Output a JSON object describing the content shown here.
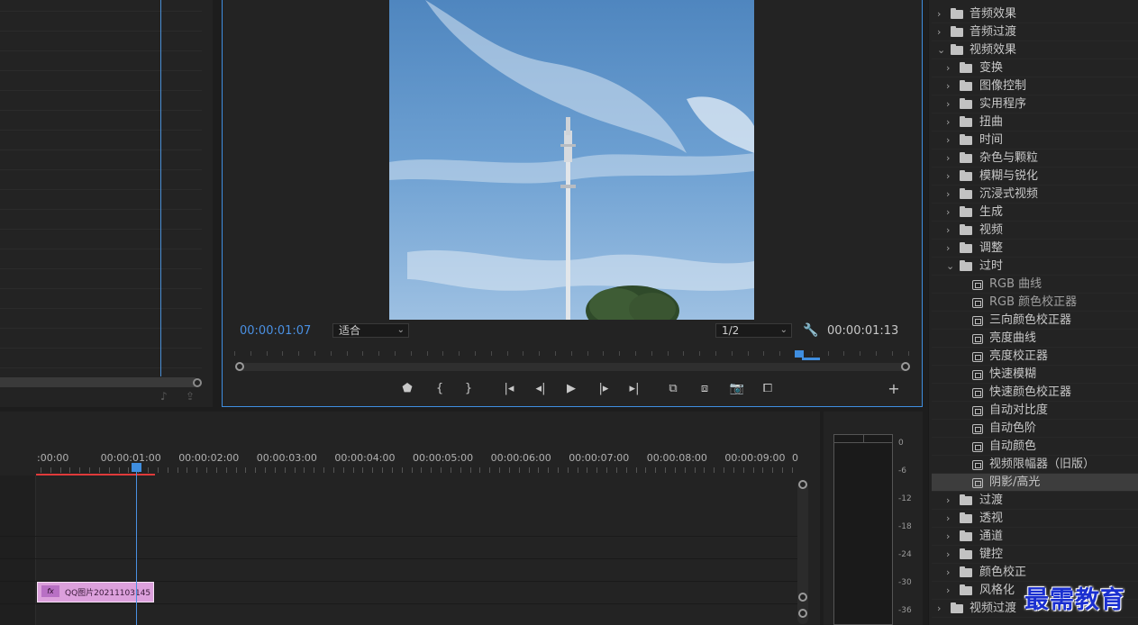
{
  "program_monitor": {
    "timecode_current": "00:00:01:07",
    "fit_select": "适合",
    "resolution_select": "1/2",
    "timecode_duration": "00:00:01:13"
  },
  "timeline": {
    "ruler_labels": [
      ":00:00",
      "00:00:01:00",
      "00:00:02:00",
      "00:00:03:00",
      "00:00:04:00",
      "00:00:05:00",
      "00:00:06:00",
      "00:00:07:00",
      "00:00:08:00",
      "00:00:09:00",
      "0"
    ],
    "clip_label": "QQ图片20211103145",
    "clip_fx": "fx"
  },
  "audio_meter": {
    "db_labels": [
      "0",
      "-6",
      "-12",
      "-18",
      "-24",
      "-30",
      "-36"
    ]
  },
  "effects": {
    "items": [
      {
        "label": "音频效果",
        "kind": "folder",
        "level": 0,
        "expanded": false
      },
      {
        "label": "音频过渡",
        "kind": "folder",
        "level": 0,
        "expanded": false
      },
      {
        "label": "视频效果",
        "kind": "folder",
        "level": 0,
        "expanded": true
      },
      {
        "label": "变换",
        "kind": "folder",
        "level": 1,
        "expanded": false
      },
      {
        "label": "图像控制",
        "kind": "folder",
        "level": 1,
        "expanded": false
      },
      {
        "label": "实用程序",
        "kind": "folder",
        "level": 1,
        "expanded": false
      },
      {
        "label": "扭曲",
        "kind": "folder",
        "level": 1,
        "expanded": false
      },
      {
        "label": "时间",
        "kind": "folder",
        "level": 1,
        "expanded": false
      },
      {
        "label": "杂色与颗粒",
        "kind": "folder",
        "level": 1,
        "expanded": false
      },
      {
        "label": "模糊与锐化",
        "kind": "folder",
        "level": 1,
        "expanded": false
      },
      {
        "label": "沉浸式视频",
        "kind": "folder",
        "level": 1,
        "expanded": false
      },
      {
        "label": "生成",
        "kind": "folder",
        "level": 1,
        "expanded": false
      },
      {
        "label": "视频",
        "kind": "folder",
        "level": 1,
        "expanded": false
      },
      {
        "label": "调整",
        "kind": "folder",
        "level": 1,
        "expanded": false
      },
      {
        "label": "过时",
        "kind": "folder",
        "level": 1,
        "expanded": true
      },
      {
        "label": "RGB 曲线",
        "kind": "effect",
        "level": 2,
        "muted": true
      },
      {
        "label": "RGB 颜色校正器",
        "kind": "effect",
        "level": 2,
        "muted": true
      },
      {
        "label": "三向颜色校正器",
        "kind": "effect",
        "level": 2
      },
      {
        "label": "亮度曲线",
        "kind": "effect",
        "level": 2
      },
      {
        "label": "亮度校正器",
        "kind": "effect",
        "level": 2
      },
      {
        "label": "快速模糊",
        "kind": "effect",
        "level": 2
      },
      {
        "label": "快速颜色校正器",
        "kind": "effect",
        "level": 2
      },
      {
        "label": "自动对比度",
        "kind": "effect",
        "level": 2
      },
      {
        "label": "自动色阶",
        "kind": "effect",
        "level": 2
      },
      {
        "label": "自动颜色",
        "kind": "effect",
        "level": 2
      },
      {
        "label": "视频限幅器（旧版）",
        "kind": "effect",
        "level": 2
      },
      {
        "label": "阴影/高光",
        "kind": "effect",
        "level": 2,
        "selected": true
      },
      {
        "label": "过渡",
        "kind": "folder",
        "level": 1,
        "expanded": false
      },
      {
        "label": "透视",
        "kind": "folder",
        "level": 1,
        "expanded": false
      },
      {
        "label": "通道",
        "kind": "folder",
        "level": 1,
        "expanded": false
      },
      {
        "label": "键控",
        "kind": "folder",
        "level": 1,
        "expanded": false
      },
      {
        "label": "颜色校正",
        "kind": "folder",
        "level": 1,
        "expanded": false
      },
      {
        "label": "风格化",
        "kind": "folder",
        "level": 1,
        "expanded": false
      },
      {
        "label": "视频过渡",
        "kind": "folder",
        "level": 0,
        "expanded": false
      }
    ]
  },
  "watermark": "最需教育",
  "colors": {
    "accent": "#3f8ee0",
    "clip": "#dca0dc",
    "work_area": "#e03a3a"
  }
}
